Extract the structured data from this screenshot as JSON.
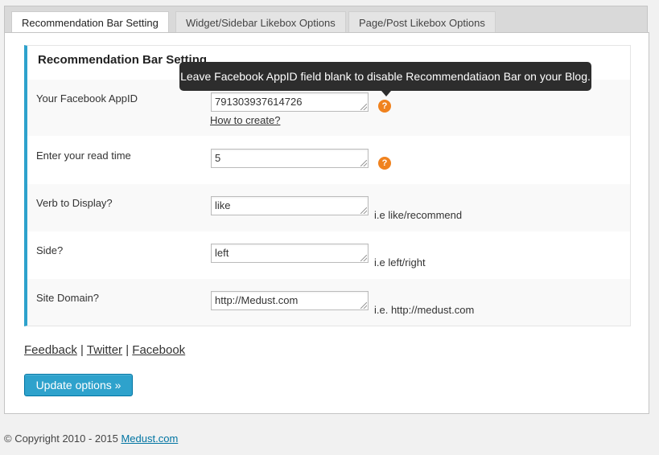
{
  "tabs": [
    {
      "label": "Recommendation Bar Setting",
      "active": true
    },
    {
      "label": "Widget/Sidebar Likebox Options",
      "active": false
    },
    {
      "label": "Page/Post Likebox Options",
      "active": false
    }
  ],
  "section": {
    "title": "Recommendation Bar Setting",
    "tooltip": "Leave Facebook AppID field blank to disable Recommendatiaon Bar on your Blog.",
    "fields": [
      {
        "label": "Your Facebook AppID",
        "value": "791303937614726",
        "link": "How to create?",
        "help_icon": "question-icon"
      },
      {
        "label": "Enter your read time",
        "value": "5",
        "help_icon": "question-icon"
      },
      {
        "label": "Verb to Display?",
        "value": "like",
        "hint": "i.e like/recommend"
      },
      {
        "label": "Side?",
        "value": "left",
        "hint": "i.e left/right"
      },
      {
        "label": "Site Domain?",
        "value": "http://Medust.com",
        "hint": "i.e. http://medust.com"
      }
    ]
  },
  "footer_links": {
    "feedback": "Feedback",
    "separator": "|",
    "twitter": "Twitter",
    "facebook": "Facebook"
  },
  "update_button": "Update options »",
  "copyright": {
    "text": "© Copyright 2010 - 2015",
    "link": "Medust.com"
  },
  "colors": {
    "accent": "#2ea2cc",
    "help_icon": "#f0821e",
    "tooltip_bg": "#2d2d2d"
  }
}
